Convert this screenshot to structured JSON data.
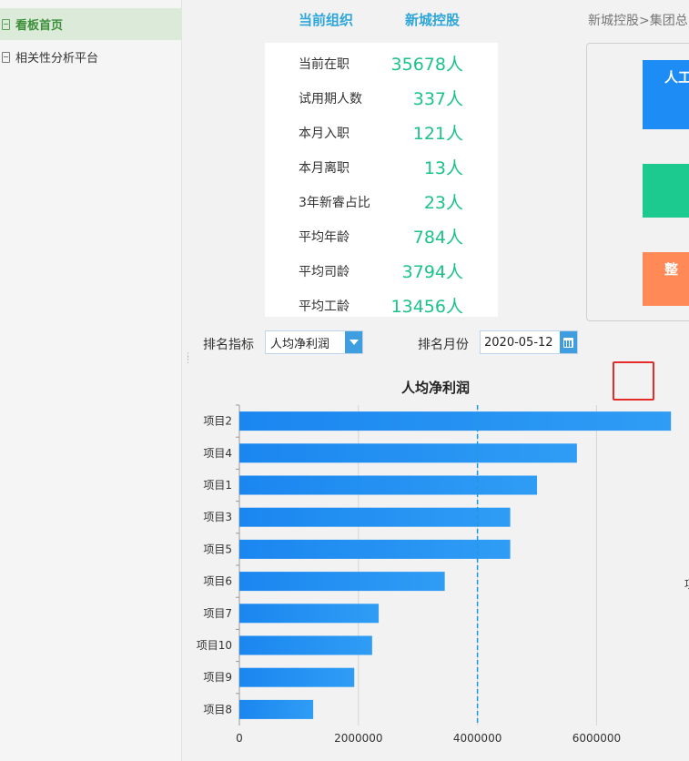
{
  "sidebar": {
    "items": [
      {
        "label": "看板首页",
        "active": true
      },
      {
        "label": "相关性分析平台",
        "active": false
      }
    ]
  },
  "header": {
    "org_label": "当前组织",
    "org_value": "新城控股",
    "breadcrumb": "新城控股>集团总"
  },
  "stats": [
    {
      "label": "当前在职",
      "value": "35678人"
    },
    {
      "label": "试用期人数",
      "value": "337人"
    },
    {
      "label": "本月入职",
      "value": "121人"
    },
    {
      "label": "本月离职",
      "value": "13人"
    },
    {
      "label": "3年新睿占比",
      "value": "23人"
    },
    {
      "label": "平均年龄",
      "value": "784人"
    },
    {
      "label": "平均司龄",
      "value": "3794人"
    },
    {
      "label": "平均工龄",
      "value": "13456人"
    }
  ],
  "tiles": [
    {
      "label": "人工",
      "color": "#1e8cf5"
    },
    {
      "label": "",
      "color": "#1cc98e"
    },
    {
      "label": "整",
      "color": "#ff8a57"
    }
  ],
  "filters": {
    "indicator_label": "排名指标",
    "indicator_value": "人均净利润",
    "month_label": "排名月份",
    "month_value": "2020-05-12"
  },
  "right_edge_hint": "项",
  "colors": {
    "accent": "#2ea6d9",
    "value_green": "#1cc28a",
    "bar": "#1e90ff",
    "highlight_box": "#e62b2b"
  },
  "chart_data": {
    "type": "bar",
    "orientation": "horizontal",
    "title": "人均净利润",
    "categories": [
      "项目2",
      "项目4",
      "项目1",
      "项目3",
      "项目5",
      "项目6",
      "项目7",
      "项目10",
      "项目9",
      "项目8"
    ],
    "values": [
      7250000,
      5670000,
      5000000,
      4550000,
      4550000,
      3450000,
      2340000,
      2230000,
      1930000,
      1240000
    ],
    "xlim": [
      0,
      7400000
    ],
    "xticks": [
      0,
      2000000,
      4000000,
      6000000
    ],
    "xtick_labels": [
      "0",
      "2000000",
      "4000000",
      "6000000"
    ],
    "reference_line": 4000000,
    "grid": true
  }
}
